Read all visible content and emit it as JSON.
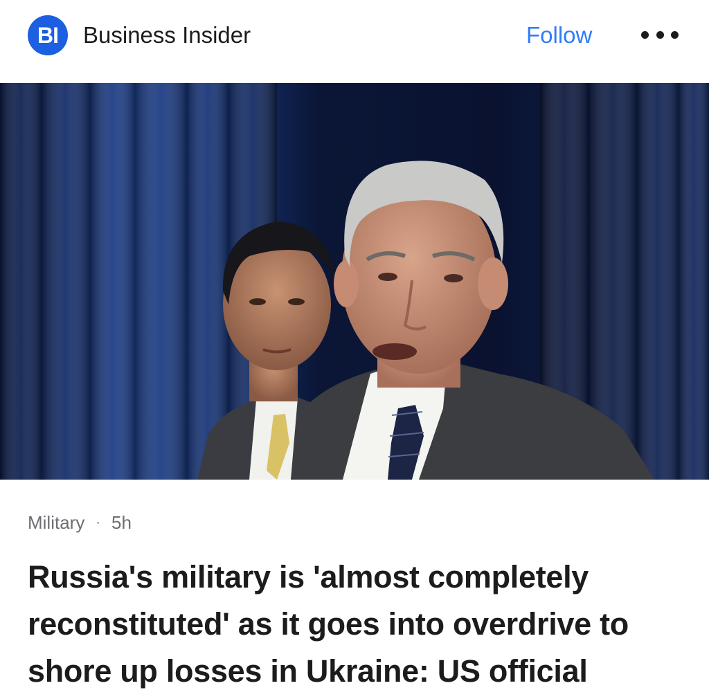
{
  "header": {
    "logo_text": "BI",
    "publisher": "Business Insider",
    "follow_label": "Follow",
    "more_icon": "more-horizontal-icon"
  },
  "colors": {
    "brand": "#1c5fe0",
    "accent": "#2f7cf6",
    "text": "#1c1c1e",
    "muted": "#6e6e73"
  },
  "article": {
    "category": "Military",
    "separator": "·",
    "time": "5h",
    "headline": "Russia's military is 'almost completely reconstituted' as it goes into overdrive to shore up losses in Ukraine: US official"
  }
}
